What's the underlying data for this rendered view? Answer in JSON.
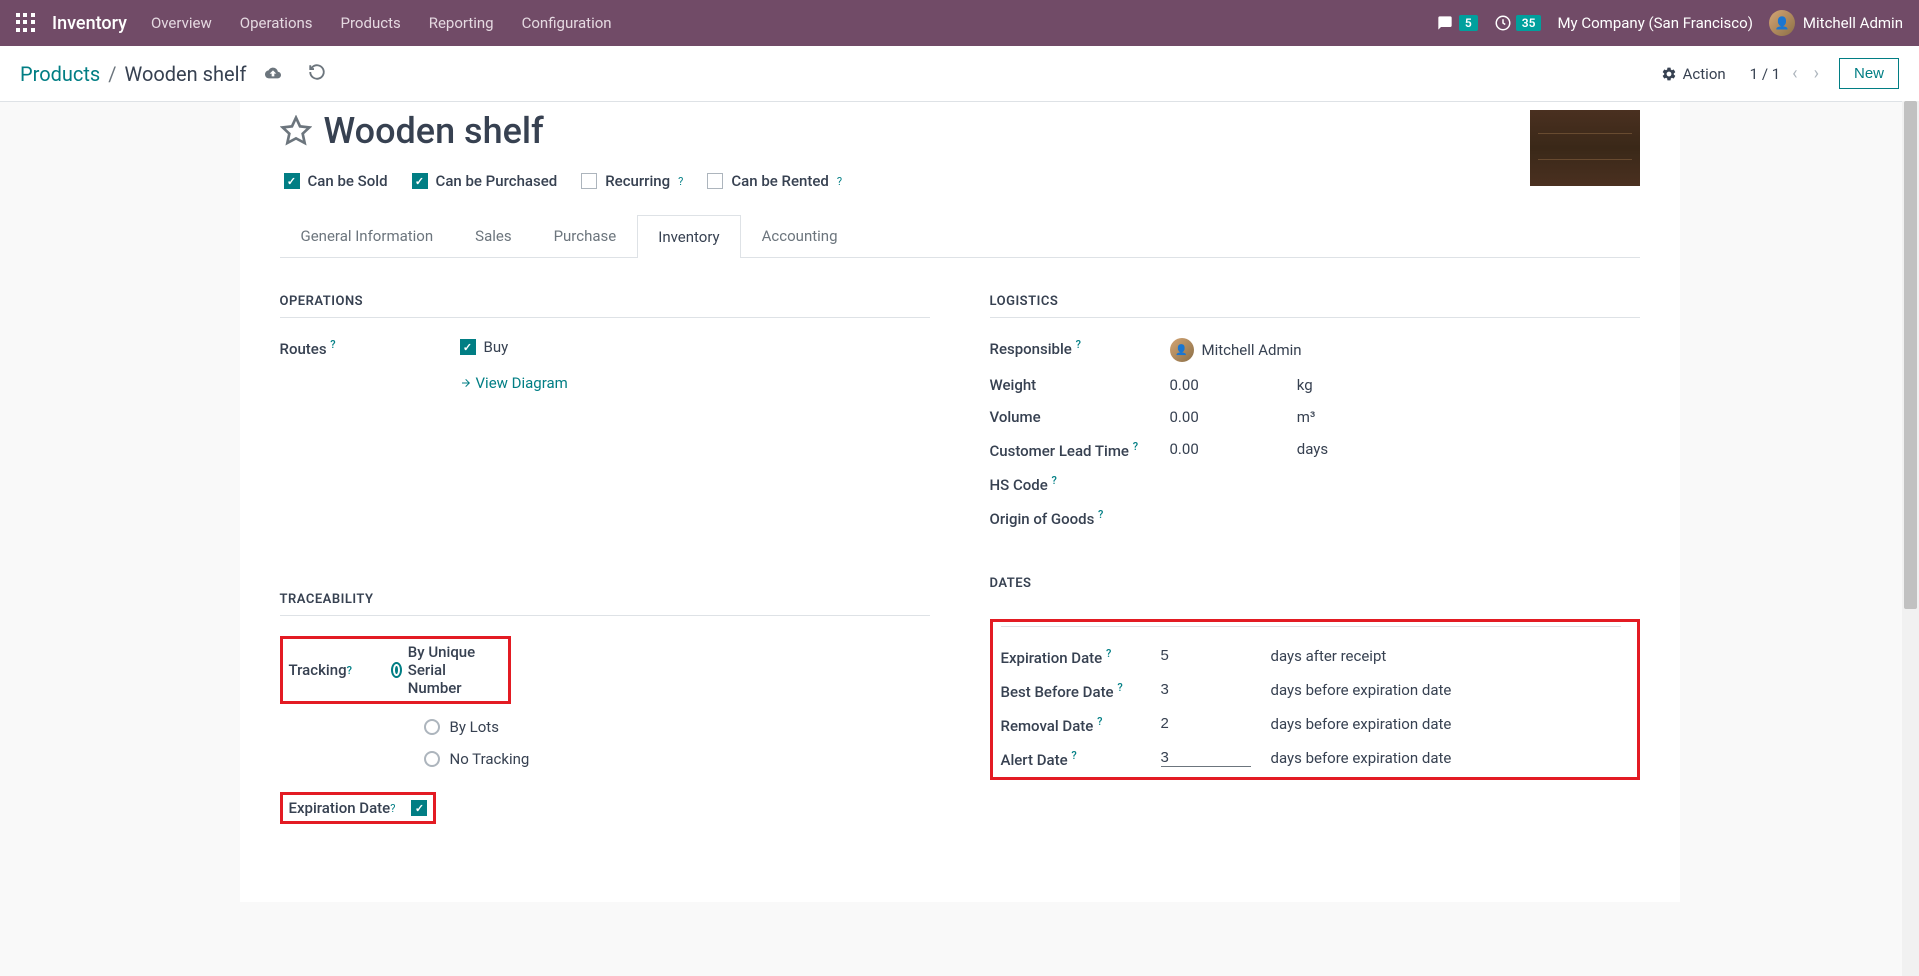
{
  "navbar": {
    "brand": "Inventory",
    "menu": [
      "Overview",
      "Operations",
      "Products",
      "Reporting",
      "Configuration"
    ],
    "chat_count": "5",
    "activity_count": "35",
    "company": "My Company (San Francisco)",
    "user": "Mitchell Admin"
  },
  "control_panel": {
    "breadcrumb_root": "Products",
    "breadcrumb_current": "Wooden shelf",
    "action_label": "Action",
    "pager": "1 / 1",
    "new_label": "New"
  },
  "product": {
    "name": "Wooden shelf",
    "can_be_sold": {
      "label": "Can be Sold",
      "checked": true
    },
    "can_be_purchased": {
      "label": "Can be Purchased",
      "checked": true
    },
    "recurring": {
      "label": "Recurring",
      "checked": false
    },
    "can_be_rented": {
      "label": "Can be Rented",
      "checked": false
    }
  },
  "tabs": [
    "General Information",
    "Sales",
    "Purchase",
    "Inventory",
    "Accounting"
  ],
  "active_tab": "Inventory",
  "operations": {
    "title": "OPERATIONS",
    "routes_label": "Routes",
    "buy_label": "Buy",
    "view_diagram": "View Diagram"
  },
  "traceability": {
    "title": "TRACEABILITY",
    "tracking_label": "Tracking",
    "options": [
      "By Unique Serial Number",
      "By Lots",
      "No Tracking"
    ],
    "selected": 0,
    "expiration_label": "Expiration Date",
    "expiration_checked": true
  },
  "logistics": {
    "title": "LOGISTICS",
    "responsible_label": "Responsible",
    "responsible_value": "Mitchell Admin",
    "weight_label": "Weight",
    "weight_value": "0.00",
    "weight_unit": "kg",
    "volume_label": "Volume",
    "volume_value": "0.00",
    "volume_unit": "m³",
    "lead_time_label": "Customer Lead Time",
    "lead_time_value": "0.00",
    "lead_time_unit": "days",
    "hs_code_label": "HS Code",
    "origin_label": "Origin of Goods"
  },
  "dates": {
    "title": "DATES",
    "expiration_label": "Expiration Date",
    "expiration_value": "5",
    "expiration_suffix": "days after receipt",
    "best_before_label": "Best Before Date",
    "best_before_value": "3",
    "best_before_suffix": "days before expiration date",
    "removal_label": "Removal Date",
    "removal_value": "2",
    "removal_suffix": "days before expiration date",
    "alert_label": "Alert Date",
    "alert_value": "3",
    "alert_suffix": "days before expiration date"
  }
}
